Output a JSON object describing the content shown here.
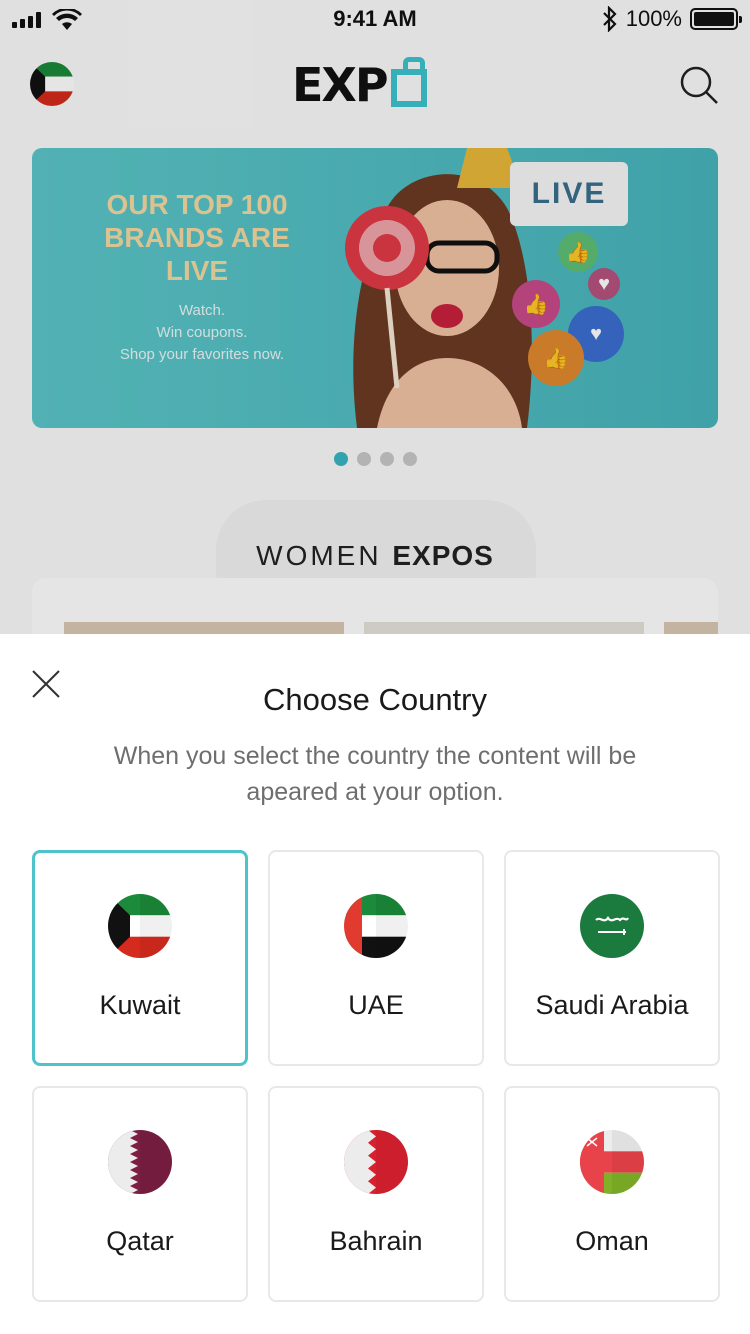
{
  "status_bar": {
    "time": "9:41 AM",
    "battery": "100%"
  },
  "header": {
    "logo_text": "EXP",
    "flag": "kuwait-flag-icon",
    "search_icon": "search-icon"
  },
  "banner": {
    "title": "OUR TOP 100 BRANDS ARE LIVE",
    "subtitle_lines": [
      "Watch.",
      "Win coupons.",
      "Shop your favorites now."
    ],
    "badge": "LIVE",
    "active_slide": 1,
    "slide_count": 4
  },
  "section": {
    "title_light": "WOMEN",
    "title_bold": "EXPOS"
  },
  "sheet": {
    "title": "Choose Country",
    "description": "When you select the country the content will be apeared at your option.",
    "close_icon": "close-icon",
    "selected": "Kuwait",
    "countries": [
      {
        "name": "Kuwait",
        "flag": "kuwait-flag-icon"
      },
      {
        "name": "UAE",
        "flag": "uae-flag-icon"
      },
      {
        "name": "Saudi Arabia",
        "flag": "saudi-arabia-flag-icon"
      },
      {
        "name": "Qatar",
        "flag": "qatar-flag-icon"
      },
      {
        "name": "Bahrain",
        "flag": "bahrain-flag-icon"
      },
      {
        "name": "Oman",
        "flag": "oman-flag-icon"
      }
    ]
  },
  "colors": {
    "accent": "#4fc3cc",
    "banner": "#4fbdc2",
    "title_gold": "#f4d9a2"
  }
}
